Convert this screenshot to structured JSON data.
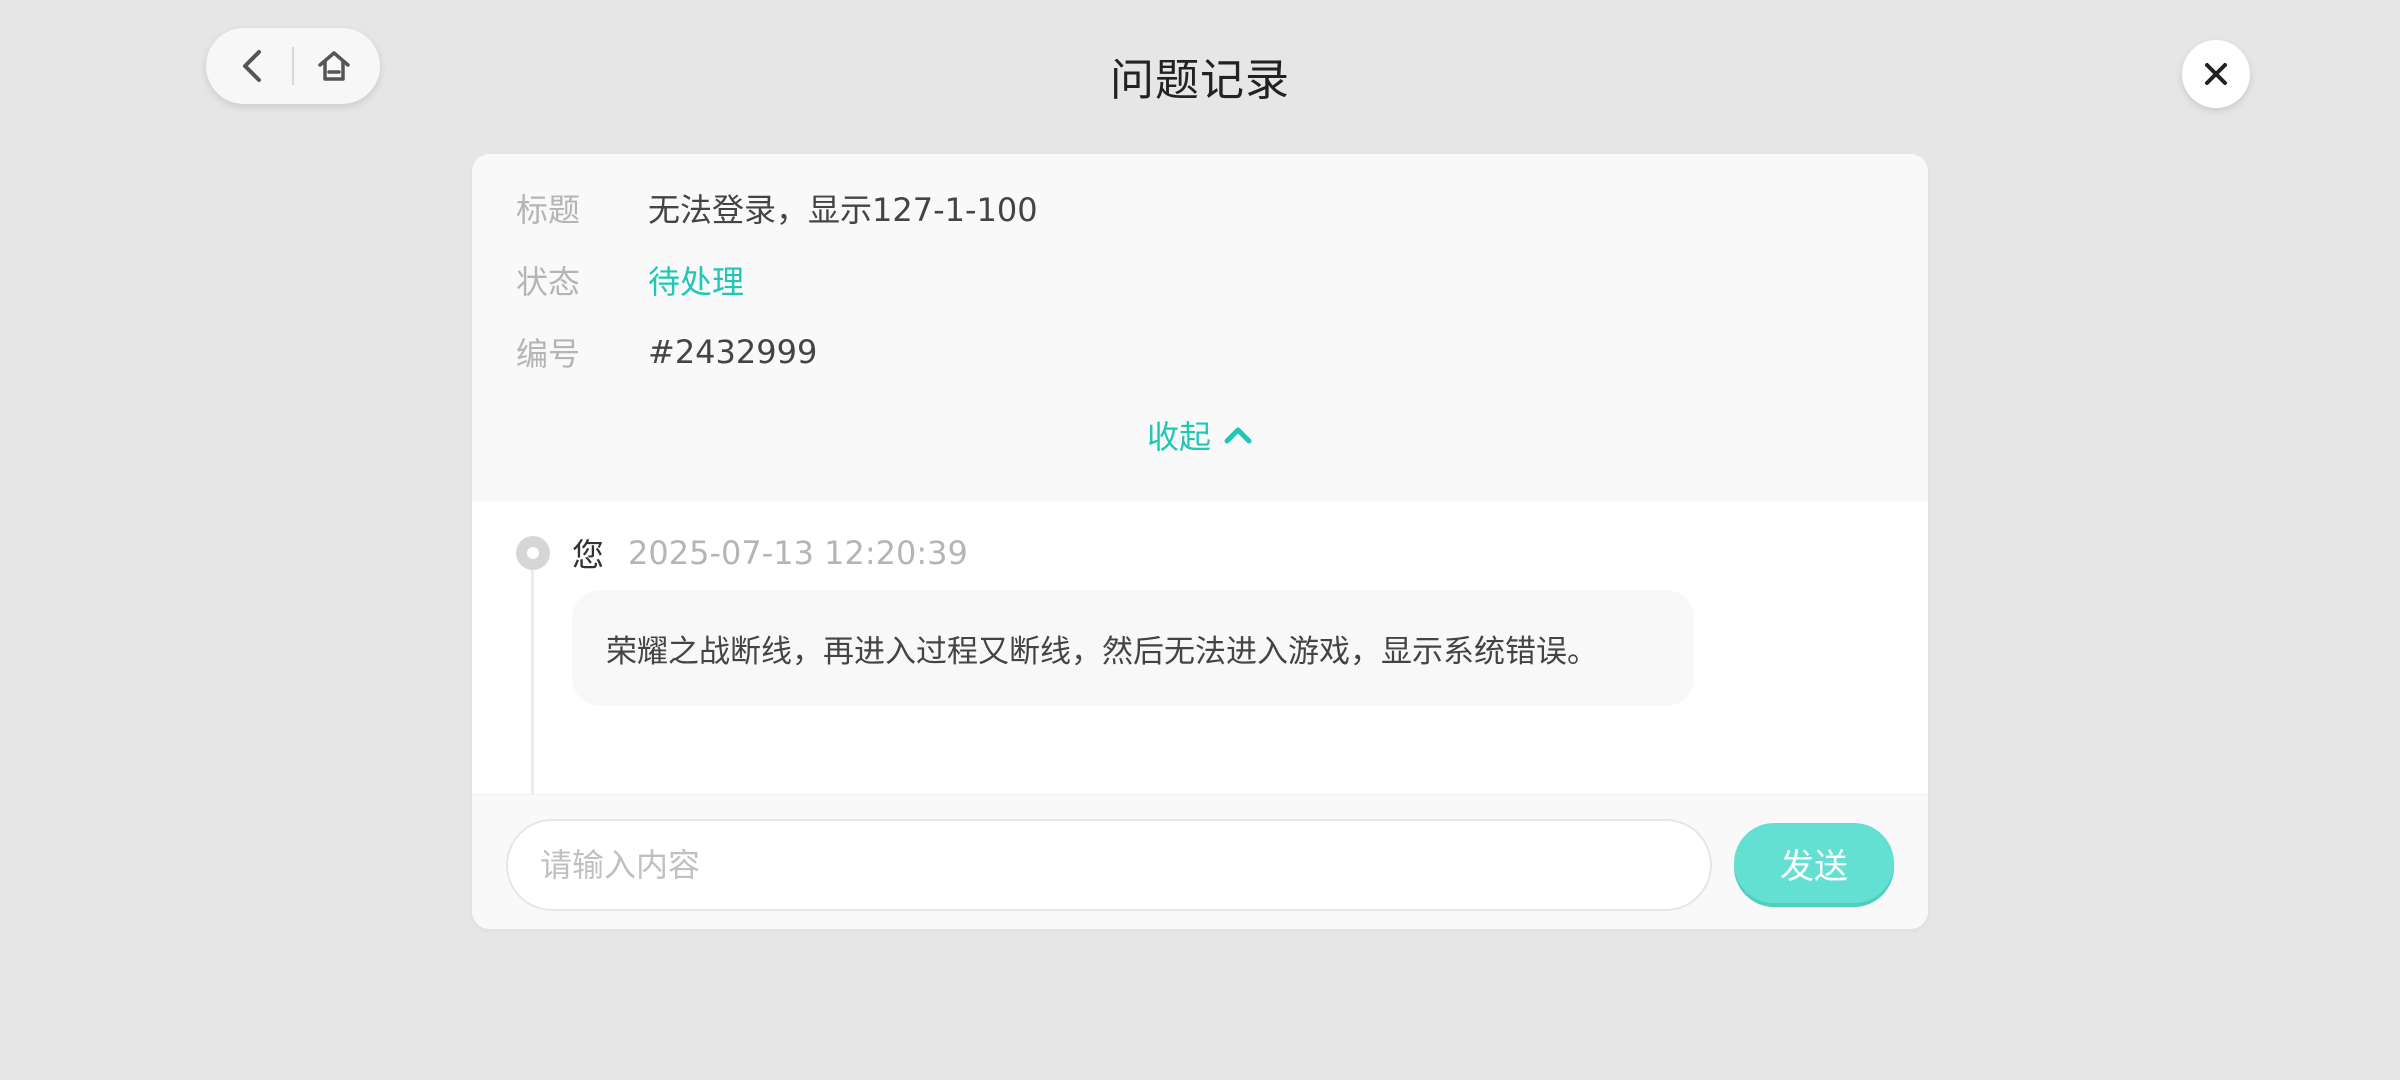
{
  "header": {
    "title": "问题记录",
    "back_icon": "chevron-left-icon",
    "home_icon": "home-icon",
    "close_icon": "close-icon"
  },
  "ticket": {
    "fields": [
      {
        "label": "标题",
        "value": "无法登录，显示127-1-100"
      },
      {
        "label": "状态",
        "value": "待处理"
      },
      {
        "label": "编号",
        "value": "#2432999"
      }
    ],
    "collapse_label": "收起"
  },
  "messages": [
    {
      "author": "您",
      "time": "2025-07-13 12:20:39",
      "text": "荣耀之战断线，再进入过程又断线，然后无法进入游戏，显示系统错误。"
    }
  ],
  "composer": {
    "placeholder": "请输入内容",
    "value": "",
    "send_label": "发送"
  },
  "colors": {
    "accent": "#1fc7b4",
    "send_button": "#63e0d2",
    "background": "#e6e6e6"
  }
}
